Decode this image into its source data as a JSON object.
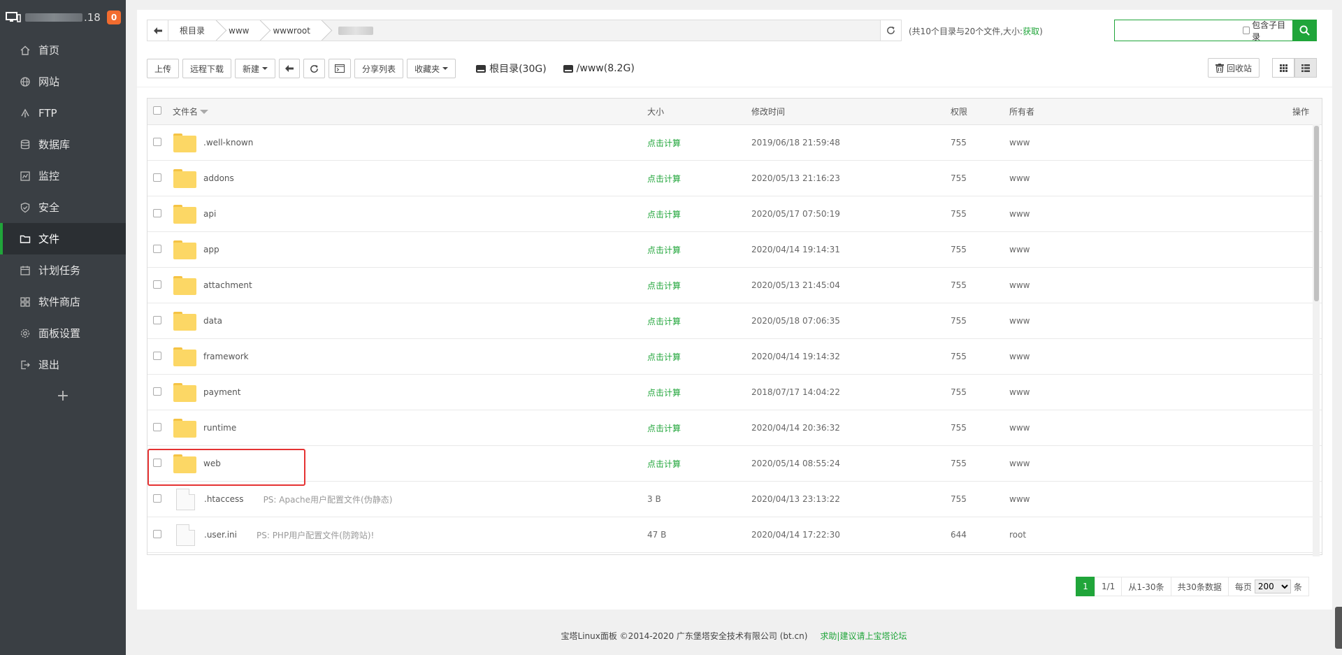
{
  "sidebar": {
    "ip_suffix": ".18",
    "badge": "0",
    "items": [
      {
        "label": "首页",
        "icon": "home-icon"
      },
      {
        "label": "网站",
        "icon": "globe-icon"
      },
      {
        "label": "FTP",
        "icon": "ftp-icon"
      },
      {
        "label": "数据库",
        "icon": "database-icon"
      },
      {
        "label": "监控",
        "icon": "monitor-icon"
      },
      {
        "label": "安全",
        "icon": "shield-icon"
      },
      {
        "label": "文件",
        "icon": "folder-icon"
      },
      {
        "label": "计划任务",
        "icon": "calendar-icon"
      },
      {
        "label": "软件商店",
        "icon": "grid-icon"
      },
      {
        "label": "面板设置",
        "icon": "gear-icon"
      },
      {
        "label": "退出",
        "icon": "logout-icon"
      }
    ],
    "active_index": 6,
    "add_label": "+"
  },
  "path": {
    "crumbs": [
      "根目录",
      "www",
      "wwwroot"
    ],
    "summary_prefix": "(共10个目录与20个文件,大小:",
    "summary_link": "获取",
    "summary_suffix": ")"
  },
  "search": {
    "placeholder": "",
    "subdir_label": "包含子目录"
  },
  "toolbar": {
    "upload": "上传",
    "remote_download": "远程下载",
    "new": "新建",
    "share_list": "分享列表",
    "favorites": "收藏夹",
    "disk_root": "根目录(30G)",
    "disk_www": "/www(8.2G)",
    "recycle": "回收站"
  },
  "table": {
    "headers": {
      "name": "文件名",
      "size": "大小",
      "mtime": "修改时间",
      "perm": "权限",
      "owner": "所有者",
      "op": "操作"
    },
    "rows": [
      {
        "type": "folder",
        "name": ".well-known",
        "size": "点击计算",
        "mtime": "2019/06/18 21:59:48",
        "perm": "755",
        "owner": "www",
        "ps": ""
      },
      {
        "type": "folder",
        "name": "addons",
        "size": "点击计算",
        "mtime": "2020/05/13 21:16:23",
        "perm": "755",
        "owner": "www",
        "ps": ""
      },
      {
        "type": "folder",
        "name": "api",
        "size": "点击计算",
        "mtime": "2020/05/17 07:50:19",
        "perm": "755",
        "owner": "www",
        "ps": ""
      },
      {
        "type": "folder",
        "name": "app",
        "size": "点击计算",
        "mtime": "2020/04/14 19:14:31",
        "perm": "755",
        "owner": "www",
        "ps": ""
      },
      {
        "type": "folder",
        "name": "attachment",
        "size": "点击计算",
        "mtime": "2020/05/13 21:45:04",
        "perm": "755",
        "owner": "www",
        "ps": ""
      },
      {
        "type": "folder",
        "name": "data",
        "size": "点击计算",
        "mtime": "2020/05/18 07:06:35",
        "perm": "755",
        "owner": "www",
        "ps": ""
      },
      {
        "type": "folder",
        "name": "framework",
        "size": "点击计算",
        "mtime": "2020/04/14 19:14:32",
        "perm": "755",
        "owner": "www",
        "ps": ""
      },
      {
        "type": "folder",
        "name": "payment",
        "size": "点击计算",
        "mtime": "2018/07/17 14:04:22",
        "perm": "755",
        "owner": "www",
        "ps": ""
      },
      {
        "type": "folder",
        "name": "runtime",
        "size": "点击计算",
        "mtime": "2020/04/14 20:36:32",
        "perm": "755",
        "owner": "www",
        "ps": ""
      },
      {
        "type": "folder",
        "name": "web",
        "size": "点击计算",
        "mtime": "2020/05/14 08:55:24",
        "perm": "755",
        "owner": "www",
        "ps": ""
      },
      {
        "type": "file",
        "name": ".htaccess",
        "size": "3 B",
        "mtime": "2020/04/13 23:13:22",
        "perm": "755",
        "owner": "www",
        "ps": "PS: Apache用户配置文件(伪静态)"
      },
      {
        "type": "file",
        "name": ".user.ini",
        "size": "47 B",
        "mtime": "2020/04/14 17:22:30",
        "perm": "644",
        "owner": "root",
        "ps": "PS: PHP用户配置文件(防跨站)!"
      }
    ]
  },
  "pagination": {
    "current": "1",
    "pages": "1/1",
    "range": "从1-30条",
    "total": "共30条数据",
    "per_page_label": "每页",
    "per_page": "200",
    "unit": "条"
  },
  "footer": {
    "copyright": "宝塔Linux面板 ©2014-2020 广东堡塔安全技术有限公司 (bt.cn)",
    "help": "求助|建议请上宝塔论坛"
  },
  "colors": {
    "accent": "#20a53a",
    "sidebar_bg": "#3a3f44",
    "badge": "#f26c2f",
    "folder": "#fcd765",
    "highlight": "#e53333"
  }
}
